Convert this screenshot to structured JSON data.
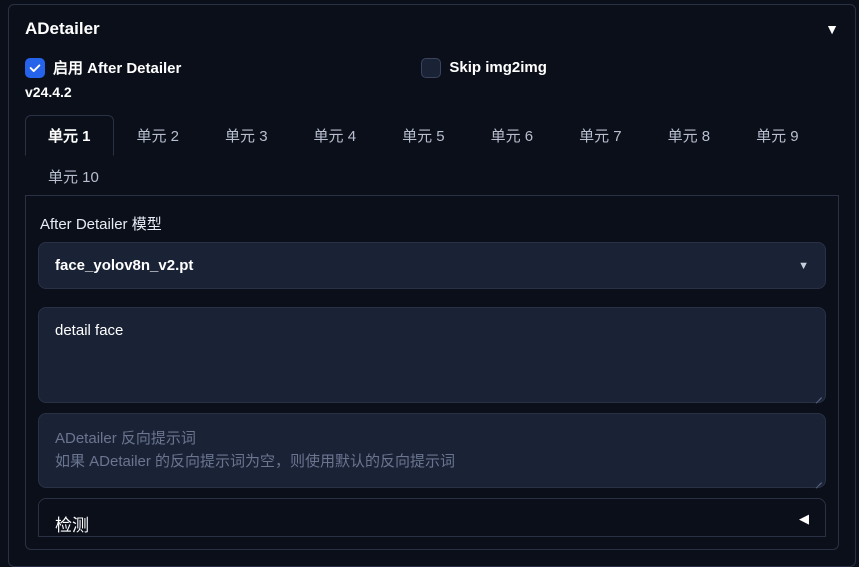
{
  "panel": {
    "title": "ADetailer",
    "version": "v24.4.2"
  },
  "checkboxes": {
    "enable_label": "启用 After Detailer",
    "enable_checked": true,
    "skip_label": "Skip img2img",
    "skip_checked": false
  },
  "tabs": [
    {
      "label": "单元 1",
      "active": true
    },
    {
      "label": "单元 2",
      "active": false
    },
    {
      "label": "单元 3",
      "active": false
    },
    {
      "label": "单元 4",
      "active": false
    },
    {
      "label": "单元 5",
      "active": false
    },
    {
      "label": "单元 6",
      "active": false
    },
    {
      "label": "单元 7",
      "active": false
    },
    {
      "label": "单元 8",
      "active": false
    },
    {
      "label": "单元 9",
      "active": false
    },
    {
      "label": "单元 10",
      "active": false
    }
  ],
  "model_section": {
    "label": "After Detailer 模型",
    "selected": "face_yolov8n_v2.pt"
  },
  "prompt": {
    "value": "detail face"
  },
  "negative_prompt": {
    "placeholder_line1": "ADetailer 反向提示词",
    "placeholder_line2": "如果 ADetailer 的反向提示词为空，则使用默认的反向提示词"
  },
  "detection": {
    "title": "检测"
  }
}
